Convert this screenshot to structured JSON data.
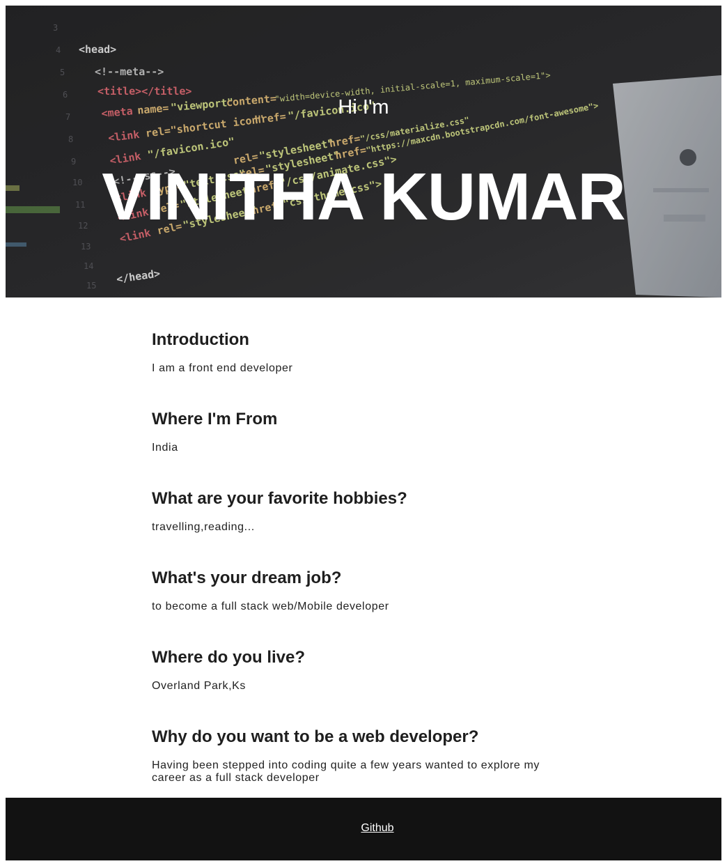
{
  "hero": {
    "greeting": "Hi I'm",
    "name": "VINITHA KUMAR",
    "background": "code-editor-photo"
  },
  "sections": [
    {
      "heading": "Introduction",
      "text": "I am a front end developer"
    },
    {
      "heading": "Where I'm From",
      "text": "India"
    },
    {
      "heading": "What are your favorite hobbies?",
      "text": "travelling,reading..."
    },
    {
      "heading": "What's your dream job?",
      "text": "to become a full stack web/Mobile developer"
    },
    {
      "heading": "Where do you live?",
      "text": "Overland Park,Ks"
    },
    {
      "heading": "Why do you want to be a web developer?",
      "text": "Having been stepped into coding quite a few years wanted to explore my career as a full stack developer"
    }
  ],
  "footer": {
    "link_label": "Github"
  },
  "colors": {
    "hero_bg": "#2b2b2d",
    "footer_bg": "#121212",
    "text": "#222222"
  }
}
